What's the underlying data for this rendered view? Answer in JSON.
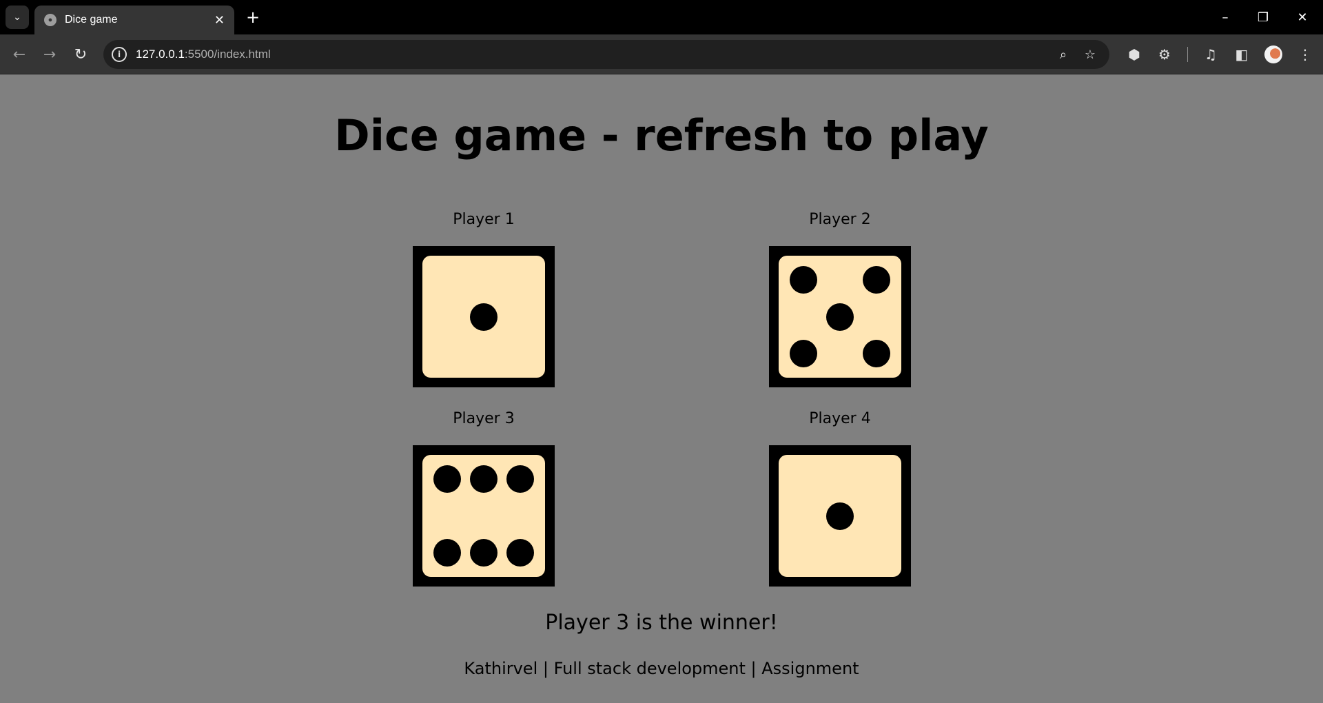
{
  "browser": {
    "tab_title": "Dice game",
    "url_host": "127.0.0.1",
    "url_path": ":5500/index.html"
  },
  "page": {
    "title": "Dice game - refresh to play",
    "players": [
      {
        "label": "Player 1",
        "die_value": 1
      },
      {
        "label": "Player 2",
        "die_value": 5
      },
      {
        "label": "Player 3",
        "die_value": 6
      },
      {
        "label": "Player 4",
        "die_value": 1
      }
    ],
    "result": "Player 3 is the winner!",
    "footer": "Kathirvel | Full stack development | Assignment"
  },
  "colors": {
    "page_background": "#808080",
    "die_face": "#ffe6b5",
    "die_border": "#000000",
    "pip": "#000000"
  }
}
